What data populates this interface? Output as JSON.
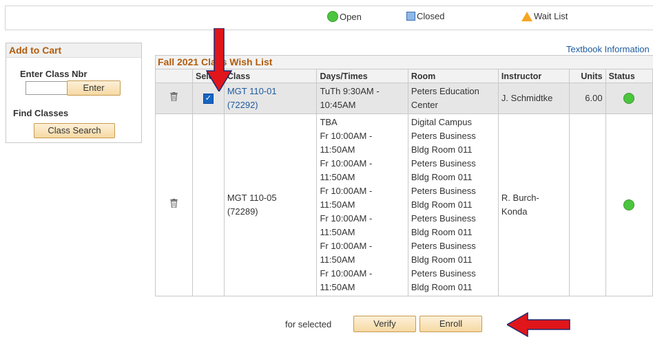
{
  "legend": {
    "open_label": "Open",
    "closed_label": "Closed",
    "wait_label": "Wait List"
  },
  "cart": {
    "title": "Add to Cart",
    "enter_class_nbr_label": "Enter Class Nbr",
    "class_nbr_value": "",
    "enter_button": "Enter",
    "find_classes_label": "Find Classes",
    "class_search_button": "Class Search"
  },
  "textbook_link": "Textbook Information",
  "wishlist": {
    "title": "Fall 2021 Class Wish List",
    "columns": [
      "",
      "Select",
      "Class",
      "Days/Times",
      "Room",
      "Instructor",
      "Units",
      "Status"
    ],
    "rows": [
      {
        "class": "MGT 110-01 (72292)",
        "class_line1": "MGT 110-01",
        "class_line2": "(72292)",
        "selected": true,
        "days_times": [
          "TuTh 9:30AM -",
          "10:45AM"
        ],
        "room": [
          "Peters Education",
          "Center"
        ],
        "instructor": "J. Schmidtke",
        "units": "6.00",
        "status": "open"
      },
      {
        "class": "MGT 110-05 (72289)",
        "class_line1": "MGT 110-05",
        "class_line2": "(72289)",
        "selected": false,
        "days_times": [
          "TBA",
          "Fr 10:00AM -",
          "11:50AM",
          "Fr 10:00AM -",
          "11:50AM",
          "Fr 10:00AM -",
          "11:50AM",
          "Fr 10:00AM -",
          "11:50AM",
          "Fr 10:00AM -",
          "11:50AM",
          "Fr 10:00AM -",
          "11:50AM"
        ],
        "room": [
          "Digital Campus",
          "Peters Business",
          "Bldg Room 011",
          "Peters Business",
          "Bldg Room 011",
          "Peters Business",
          "Bldg Room 011",
          "Peters Business",
          "Bldg Room 011",
          "Peters Business",
          "Bldg Room 011",
          "Peters Business",
          "Bldg Room 011"
        ],
        "instructor_line1": "R. Burch-",
        "instructor_line2": "Konda",
        "units": "",
        "status": "open"
      }
    ]
  },
  "footer": {
    "for_selected": "for selected",
    "verify_button": "Verify",
    "enroll_button": "Enroll"
  },
  "colors": {
    "open": "#4cc53e",
    "header_text": "#b25c0b",
    "link": "#1d5a9e",
    "annotation_arrow": "#e0161b"
  }
}
